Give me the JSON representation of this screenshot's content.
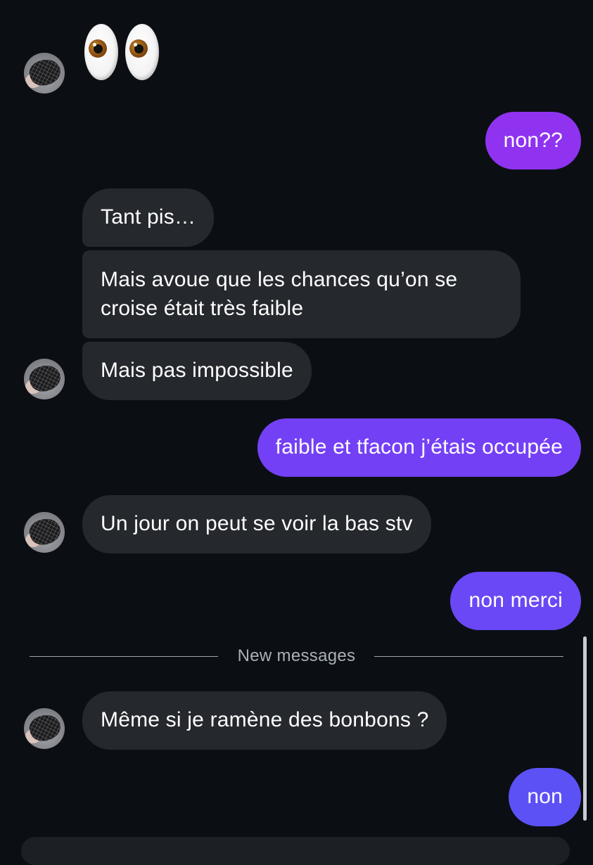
{
  "messages": {
    "emoji": "👀",
    "sent_1": "non??",
    "recv_1": "Tant pis…",
    "recv_2_line1": "Mais avoue que les chances qu’on se",
    "recv_2_line2": "croise était très faible",
    "recv_3": "Mais pas impossible",
    "sent_2": "faible et tfacon j’étais occupée",
    "recv_4": "Un jour on peut se voir la bas stv",
    "sent_3": "non merci",
    "divider_label": "New messages",
    "recv_5": "Même si je ramène des bonbons ?",
    "sent_4": "non"
  },
  "colors": {
    "background": "#0b0f14",
    "received_bubble": "#25282d",
    "sent_gradient": [
      "#9b2ff0",
      "#7a3cf5",
      "#5b50f5"
    ],
    "divider": "#9aa3ad"
  },
  "icons": {
    "avatar": "contact-avatar-photo",
    "emoji": "eyes-emoji"
  }
}
